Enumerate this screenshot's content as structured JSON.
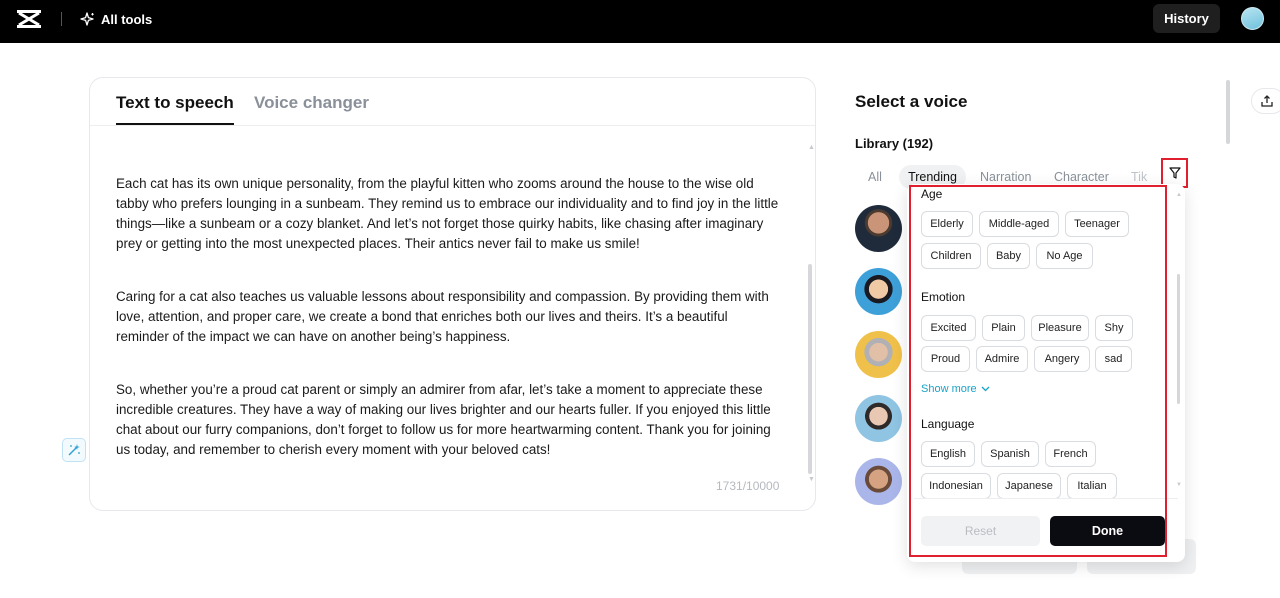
{
  "header": {
    "logo_icon": "capcut-logo-icon",
    "all_tools_label": "All tools",
    "history_label": "History"
  },
  "editor": {
    "tabs": [
      {
        "label": "Text to speech",
        "active": true
      },
      {
        "label": "Voice changer",
        "active": false
      }
    ],
    "paragraphs": [
      "Each cat has its own unique personality, from the playful kitten who zooms around the house to the wise old tabby who prefers lounging in a sunbeam. They remind us to embrace our individuality and to find joy in the little things—like a sunbeam or a cozy blanket. And let’s not forget those quirky habits, like chasing after imaginary prey or getting into the most unexpected places. Their antics never fail to make us smile!",
      "Caring for a cat also teaches us valuable lessons about responsibility and compassion. By providing them with love, attention, and proper care, we create a bond that enriches both our lives and theirs. It’s a beautiful reminder of the impact we can have on another being’s happiness.",
      "So, whether you’re a proud cat parent or simply an admirer from afar, let’s take a moment to appreciate these incredible creatures. They have a way of making our lives brighter and our hearts fuller. If you enjoyed this little chat about our furry companions, don’t forget to follow us for more heartwarming content. Thank you for joining us today, and remember to cherish every moment with your beloved cats!"
    ],
    "char_count": "1731/10000"
  },
  "voice_panel": {
    "title": "Select a voice",
    "library_label": "Library (192)",
    "categories": [
      "All",
      "Trending",
      "Narration",
      "Character",
      "Tik"
    ],
    "selected_category": "Trending"
  },
  "filter": {
    "age_label": "Age",
    "age_options": [
      "Elderly",
      "Middle-aged",
      "Teenager",
      "Children",
      "Baby",
      "No Age"
    ],
    "emotion_label": "Emotion",
    "emotion_options": [
      "Excited",
      "Plain",
      "Pleasure",
      "Shy",
      "Proud",
      "Admire",
      "Angery",
      "sad"
    ],
    "show_more_label": "Show more",
    "language_label": "Language",
    "language_options": [
      "English",
      "Spanish",
      "French",
      "Indonesian",
      "Japanese",
      "Italian"
    ],
    "reset_label": "Reset",
    "done_label": "Done"
  },
  "colors": {
    "accent_link": "#1aa3c8",
    "highlight_box": "#e0202f",
    "done_button": "#0b0b12"
  }
}
